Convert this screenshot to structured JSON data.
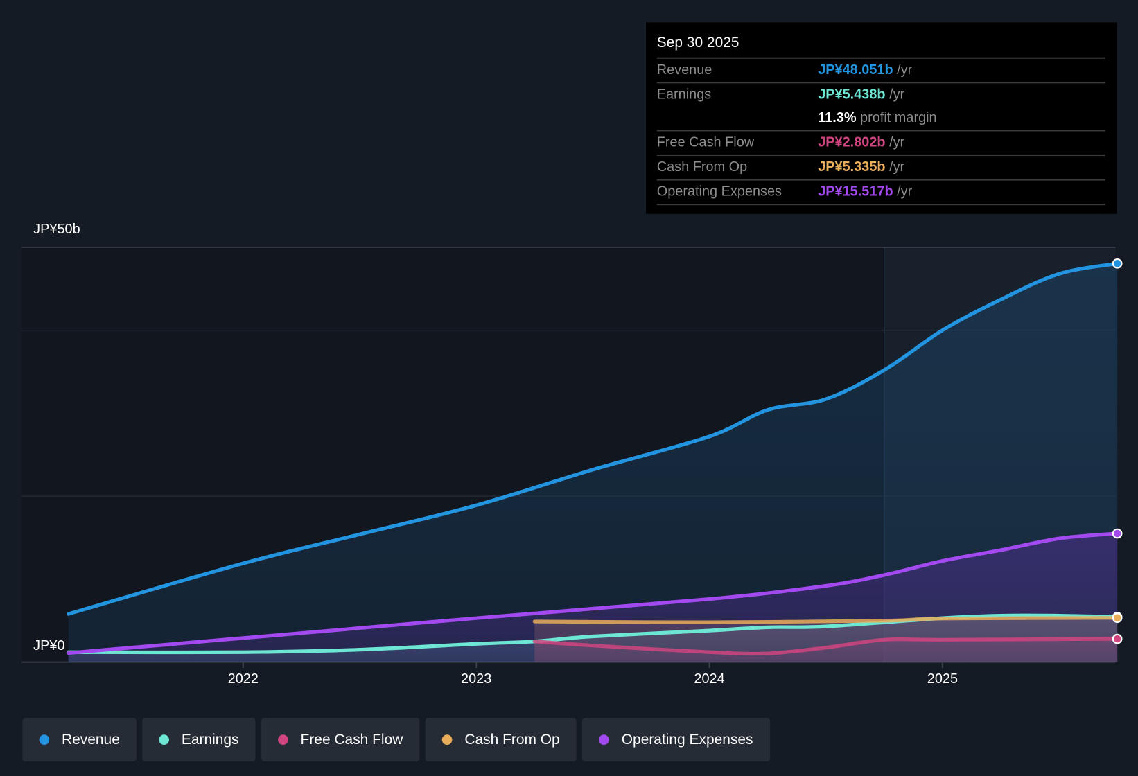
{
  "tooltip": {
    "date": "Sep 30 2025",
    "rows": [
      {
        "label": "Revenue",
        "value": "JP¥48.051b",
        "unit": " /yr",
        "color": "#2394df"
      },
      {
        "label": "Earnings",
        "value": "JP¥5.438b",
        "unit": " /yr",
        "color": "#6ee6d4"
      },
      {
        "label": "",
        "value": "11.3%",
        "unit": " profit margin",
        "color": "#ffffff"
      },
      {
        "label": "Free Cash Flow",
        "value": "JP¥2.802b",
        "unit": " /yr",
        "color": "#d0457f"
      },
      {
        "label": "Cash From Op",
        "value": "JP¥5.335b",
        "unit": " /yr",
        "color": "#e9ad5b"
      },
      {
        "label": "Operating Expenses",
        "value": "JP¥15.517b",
        "unit": " /yr",
        "color": "#a349f0"
      }
    ]
  },
  "chart_data": {
    "type": "line",
    "ylabel_top": "JP¥50b",
    "ylabel_bottom": "JP¥0",
    "ylim": [
      0,
      50
    ],
    "xlim": [
      2021.0,
      2025.75
    ],
    "xticks": [
      "2022",
      "2023",
      "2024",
      "2025"
    ],
    "xtick_values": [
      2022,
      2023,
      2024,
      2025
    ],
    "forecast_shade_start": 2024.75,
    "series": [
      {
        "name": "Revenue",
        "color": "#2394df",
        "x": [
          2021.25,
          2022,
          2022.5,
          2023,
          2023.5,
          2024,
          2024.25,
          2024.5,
          2024.75,
          2025,
          2025.25,
          2025.5,
          2025.75
        ],
        "values": [
          5.8,
          11.9,
          15.4,
          18.9,
          23.2,
          27.2,
          30.4,
          31.7,
          35.2,
          40.0,
          43.7,
          46.8,
          48.05
        ]
      },
      {
        "name": "Earnings",
        "color": "#6ee6d4",
        "x": [
          2021.25,
          2022,
          2022.5,
          2023,
          2023.25,
          2023.5,
          2024,
          2024.25,
          2024.5,
          2025,
          2025.25,
          2025.5,
          2025.75
        ],
        "values": [
          1.2,
          1.2,
          1.5,
          2.2,
          2.5,
          3.1,
          3.8,
          4.2,
          4.3,
          5.3,
          5.6,
          5.6,
          5.44
        ]
      },
      {
        "name": "Free Cash Flow",
        "color": "#d0457f",
        "x": [
          2023.25,
          2023.5,
          2024,
          2024.25,
          2024.5,
          2024.75,
          2025,
          2025.75
        ],
        "values": [
          2.5,
          2.0,
          1.2,
          1.05,
          1.75,
          2.7,
          2.7,
          2.8
        ]
      },
      {
        "name": "Cash From Op",
        "color": "#e9ad5b",
        "x": [
          2023.25,
          2024,
          2024.75,
          2025,
          2025.75
        ],
        "values": [
          4.9,
          4.8,
          5.0,
          5.25,
          5.335
        ]
      },
      {
        "name": "Operating Expenses",
        "color": "#a349f0",
        "x": [
          2021.25,
          2022,
          2023,
          2024,
          2024.5,
          2024.75,
          2025,
          2025.25,
          2025.5,
          2025.75
        ],
        "values": [
          1.1,
          2.9,
          5.3,
          7.6,
          9.2,
          10.5,
          12.2,
          13.5,
          14.9,
          15.5
        ]
      }
    ]
  }
}
